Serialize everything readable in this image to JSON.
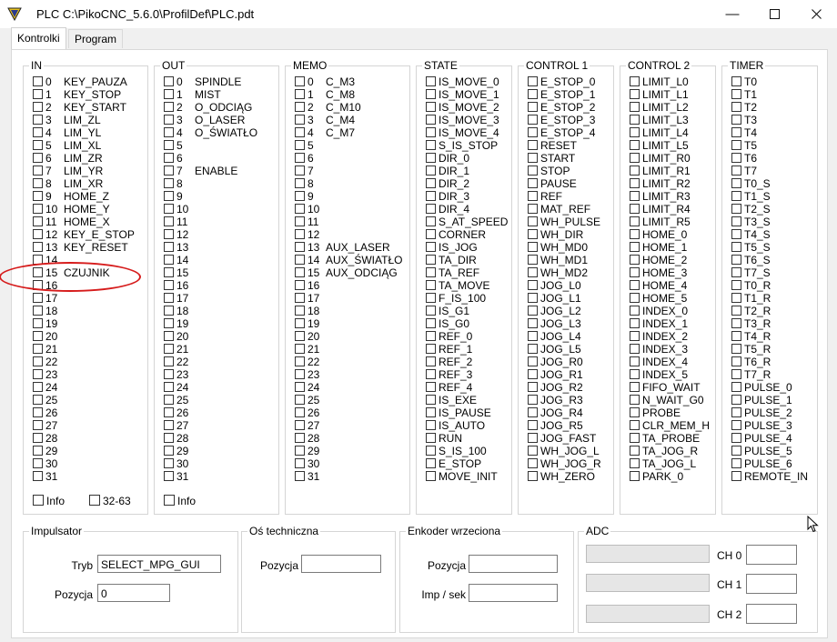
{
  "window": {
    "title": "PLC C:\\PikoCNC_5.6.0\\ProfilDef\\PLC.pdt"
  },
  "tabs": [
    {
      "label": "Kontrolki",
      "active": true
    },
    {
      "label": "Program",
      "active": false
    }
  ],
  "groups": [
    {
      "title": "IN",
      "items": [
        {
          "num": "0",
          "label": "KEY_PAUZA"
        },
        {
          "num": "1",
          "label": "KEY_STOP"
        },
        {
          "num": "2",
          "label": "KEY_START"
        },
        {
          "num": "3",
          "label": "LIM_ZL"
        },
        {
          "num": "4",
          "label": "LIM_YL"
        },
        {
          "num": "5",
          "label": "LIM_XL"
        },
        {
          "num": "6",
          "label": "LIM_ZR"
        },
        {
          "num": "7",
          "label": "LIM_YR"
        },
        {
          "num": "8",
          "label": "LIM_XR"
        },
        {
          "num": "9",
          "label": "HOME_Z"
        },
        {
          "num": "10",
          "label": "HOME_Y"
        },
        {
          "num": "11",
          "label": "HOME_X"
        },
        {
          "num": "12",
          "label": "KEY_E_STOP"
        },
        {
          "num": "13",
          "label": "KEY_RESET"
        },
        {
          "num": "14",
          "label": ""
        },
        {
          "num": "15",
          "label": "CZUJNIK"
        },
        {
          "num": "16",
          "label": ""
        },
        {
          "num": "17",
          "label": ""
        },
        {
          "num": "18",
          "label": ""
        },
        {
          "num": "19",
          "label": ""
        },
        {
          "num": "20",
          "label": ""
        },
        {
          "num": "21",
          "label": ""
        },
        {
          "num": "22",
          "label": ""
        },
        {
          "num": "23",
          "label": ""
        },
        {
          "num": "24",
          "label": ""
        },
        {
          "num": "25",
          "label": ""
        },
        {
          "num": "26",
          "label": ""
        },
        {
          "num": "27",
          "label": ""
        },
        {
          "num": "28",
          "label": ""
        },
        {
          "num": "29",
          "label": ""
        },
        {
          "num": "30",
          "label": ""
        },
        {
          "num": "31",
          "label": ""
        }
      ],
      "extra": [
        {
          "label": "Info"
        },
        {
          "label": "32-63"
        }
      ]
    },
    {
      "title": "OUT",
      "items": [
        {
          "num": "0",
          "label": "SPINDLE"
        },
        {
          "num": "1",
          "label": "MIST"
        },
        {
          "num": "2",
          "label": "O_ODCIĄG"
        },
        {
          "num": "3",
          "label": "O_LASER"
        },
        {
          "num": "4",
          "label": "O_ŚWIATŁO"
        },
        {
          "num": "5",
          "label": ""
        },
        {
          "num": "6",
          "label": ""
        },
        {
          "num": "7",
          "label": "ENABLE"
        },
        {
          "num": "8",
          "label": ""
        },
        {
          "num": "9",
          "label": ""
        },
        {
          "num": "10",
          "label": ""
        },
        {
          "num": "11",
          "label": ""
        },
        {
          "num": "12",
          "label": ""
        },
        {
          "num": "13",
          "label": ""
        },
        {
          "num": "14",
          "label": ""
        },
        {
          "num": "15",
          "label": ""
        },
        {
          "num": "16",
          "label": ""
        },
        {
          "num": "17",
          "label": ""
        },
        {
          "num": "18",
          "label": ""
        },
        {
          "num": "19",
          "label": ""
        },
        {
          "num": "20",
          "label": ""
        },
        {
          "num": "21",
          "label": ""
        },
        {
          "num": "22",
          "label": ""
        },
        {
          "num": "23",
          "label": ""
        },
        {
          "num": "24",
          "label": ""
        },
        {
          "num": "25",
          "label": ""
        },
        {
          "num": "26",
          "label": ""
        },
        {
          "num": "27",
          "label": ""
        },
        {
          "num": "28",
          "label": ""
        },
        {
          "num": "29",
          "label": ""
        },
        {
          "num": "30",
          "label": ""
        },
        {
          "num": "31",
          "label": ""
        }
      ],
      "extra": [
        {
          "label": "Info"
        }
      ]
    },
    {
      "title": "MEMO",
      "items": [
        {
          "num": "0",
          "label": "C_M3"
        },
        {
          "num": "1",
          "label": "C_M8"
        },
        {
          "num": "2",
          "label": "C_M10"
        },
        {
          "num": "3",
          "label": "C_M4"
        },
        {
          "num": "4",
          "label": "C_M7"
        },
        {
          "num": "5",
          "label": ""
        },
        {
          "num": "6",
          "label": ""
        },
        {
          "num": "7",
          "label": ""
        },
        {
          "num": "8",
          "label": ""
        },
        {
          "num": "9",
          "label": ""
        },
        {
          "num": "10",
          "label": ""
        },
        {
          "num": "11",
          "label": ""
        },
        {
          "num": "12",
          "label": ""
        },
        {
          "num": "13",
          "label": "AUX_LASER"
        },
        {
          "num": "14",
          "label": "AUX_ŚWIATŁO"
        },
        {
          "num": "15",
          "label": "AUX_ODCIĄG"
        },
        {
          "num": "16",
          "label": ""
        },
        {
          "num": "17",
          "label": ""
        },
        {
          "num": "18",
          "label": ""
        },
        {
          "num": "19",
          "label": ""
        },
        {
          "num": "20",
          "label": ""
        },
        {
          "num": "21",
          "label": ""
        },
        {
          "num": "22",
          "label": ""
        },
        {
          "num": "23",
          "label": ""
        },
        {
          "num": "24",
          "label": ""
        },
        {
          "num": "25",
          "label": ""
        },
        {
          "num": "26",
          "label": ""
        },
        {
          "num": "27",
          "label": ""
        },
        {
          "num": "28",
          "label": ""
        },
        {
          "num": "29",
          "label": ""
        },
        {
          "num": "30",
          "label": ""
        },
        {
          "num": "31",
          "label": ""
        }
      ],
      "extra": []
    },
    {
      "title": "STATE",
      "items": [
        {
          "num": "",
          "label": "IS_MOVE_0"
        },
        {
          "num": "",
          "label": "IS_MOVE_1"
        },
        {
          "num": "",
          "label": "IS_MOVE_2"
        },
        {
          "num": "",
          "label": "IS_MOVE_3"
        },
        {
          "num": "",
          "label": "IS_MOVE_4"
        },
        {
          "num": "",
          "label": "S_IS_STOP"
        },
        {
          "num": "",
          "label": "DIR_0"
        },
        {
          "num": "",
          "label": "DIR_1"
        },
        {
          "num": "",
          "label": "DIR_2"
        },
        {
          "num": "",
          "label": "DIR_3"
        },
        {
          "num": "",
          "label": "DIR_4"
        },
        {
          "num": "",
          "label": "S_AT_SPEED"
        },
        {
          "num": "",
          "label": "CORNER"
        },
        {
          "num": "",
          "label": "IS_JOG"
        },
        {
          "num": "",
          "label": "TA_DIR"
        },
        {
          "num": "",
          "label": "TA_REF"
        },
        {
          "num": "",
          "label": "TA_MOVE"
        },
        {
          "num": "",
          "label": "F_IS_100"
        },
        {
          "num": "",
          "label": "IS_G1"
        },
        {
          "num": "",
          "label": "IS_G0"
        },
        {
          "num": "",
          "label": "REF_0"
        },
        {
          "num": "",
          "label": "REF_1"
        },
        {
          "num": "",
          "label": "REF_2"
        },
        {
          "num": "",
          "label": "REF_3"
        },
        {
          "num": "",
          "label": "REF_4"
        },
        {
          "num": "",
          "label": "IS_EXE"
        },
        {
          "num": "",
          "label": "IS_PAUSE"
        },
        {
          "num": "",
          "label": "IS_AUTO"
        },
        {
          "num": "",
          "label": "RUN"
        },
        {
          "num": "",
          "label": "S_IS_100"
        },
        {
          "num": "",
          "label": "E_STOP"
        },
        {
          "num": "",
          "label": "MOVE_INIT"
        }
      ],
      "extra": []
    },
    {
      "title": "CONTROL 1",
      "items": [
        {
          "num": "",
          "label": "E_STOP_0"
        },
        {
          "num": "",
          "label": "E_STOP_1"
        },
        {
          "num": "",
          "label": "E_STOP_2"
        },
        {
          "num": "",
          "label": "E_STOP_3"
        },
        {
          "num": "",
          "label": "E_STOP_4"
        },
        {
          "num": "",
          "label": "RESET"
        },
        {
          "num": "",
          "label": "START"
        },
        {
          "num": "",
          "label": "STOP"
        },
        {
          "num": "",
          "label": "PAUSE"
        },
        {
          "num": "",
          "label": "REF"
        },
        {
          "num": "",
          "label": "MAT_REF"
        },
        {
          "num": "",
          "label": "WH_PULSE"
        },
        {
          "num": "",
          "label": "WH_DIR"
        },
        {
          "num": "",
          "label": "WH_MD0"
        },
        {
          "num": "",
          "label": "WH_MD1"
        },
        {
          "num": "",
          "label": "WH_MD2"
        },
        {
          "num": "",
          "label": "JOG_L0"
        },
        {
          "num": "",
          "label": "JOG_L1"
        },
        {
          "num": "",
          "label": "JOG_L2"
        },
        {
          "num": "",
          "label": "JOG_L3"
        },
        {
          "num": "",
          "label": "JOG_L4"
        },
        {
          "num": "",
          "label": "JOG_L5"
        },
        {
          "num": "",
          "label": "JOG_R0"
        },
        {
          "num": "",
          "label": "JOG_R1"
        },
        {
          "num": "",
          "label": "JOG_R2"
        },
        {
          "num": "",
          "label": "JOG_R3"
        },
        {
          "num": "",
          "label": "JOG_R4"
        },
        {
          "num": "",
          "label": "JOG_R5"
        },
        {
          "num": "",
          "label": "JOG_FAST"
        },
        {
          "num": "",
          "label": "WH_JOG_L"
        },
        {
          "num": "",
          "label": "WH_JOG_R"
        },
        {
          "num": "",
          "label": "WH_ZERO"
        }
      ],
      "extra": []
    },
    {
      "title": "CONTROL 2",
      "items": [
        {
          "num": "",
          "label": "LIMIT_L0"
        },
        {
          "num": "",
          "label": "LIMIT_L1"
        },
        {
          "num": "",
          "label": "LIMIT_L2"
        },
        {
          "num": "",
          "label": "LIMIT_L3"
        },
        {
          "num": "",
          "label": "LIMIT_L4"
        },
        {
          "num": "",
          "label": "LIMIT_L5"
        },
        {
          "num": "",
          "label": "LIMIT_R0"
        },
        {
          "num": "",
          "label": "LIMIT_R1"
        },
        {
          "num": "",
          "label": "LIMIT_R2"
        },
        {
          "num": "",
          "label": "LIMIT_R3"
        },
        {
          "num": "",
          "label": "LIMIT_R4"
        },
        {
          "num": "",
          "label": "LIMIT_R5"
        },
        {
          "num": "",
          "label": "HOME_0"
        },
        {
          "num": "",
          "label": "HOME_1"
        },
        {
          "num": "",
          "label": "HOME_2"
        },
        {
          "num": "",
          "label": "HOME_3"
        },
        {
          "num": "",
          "label": "HOME_4"
        },
        {
          "num": "",
          "label": "HOME_5"
        },
        {
          "num": "",
          "label": "INDEX_0"
        },
        {
          "num": "",
          "label": "INDEX_1"
        },
        {
          "num": "",
          "label": "INDEX_2"
        },
        {
          "num": "",
          "label": "INDEX_3"
        },
        {
          "num": "",
          "label": "INDEX_4"
        },
        {
          "num": "",
          "label": "INDEX_5"
        },
        {
          "num": "",
          "label": "FIFO_WAIT"
        },
        {
          "num": "",
          "label": "N_WAIT_G0"
        },
        {
          "num": "",
          "label": "PROBE"
        },
        {
          "num": "",
          "label": "CLR_MEM_H"
        },
        {
          "num": "",
          "label": "TA_PROBE"
        },
        {
          "num": "",
          "label": "TA_JOG_R"
        },
        {
          "num": "",
          "label": "TA_JOG_L"
        },
        {
          "num": "",
          "label": "PARK_0"
        }
      ],
      "extra": []
    },
    {
      "title": "TIMER",
      "items": [
        {
          "num": "",
          "label": "T0"
        },
        {
          "num": "",
          "label": "T1"
        },
        {
          "num": "",
          "label": "T2"
        },
        {
          "num": "",
          "label": "T3"
        },
        {
          "num": "",
          "label": "T4"
        },
        {
          "num": "",
          "label": "T5"
        },
        {
          "num": "",
          "label": "T6"
        },
        {
          "num": "",
          "label": "T7"
        },
        {
          "num": "",
          "label": "T0_S"
        },
        {
          "num": "",
          "label": "T1_S"
        },
        {
          "num": "",
          "label": "T2_S"
        },
        {
          "num": "",
          "label": "T3_S"
        },
        {
          "num": "",
          "label": "T4_S"
        },
        {
          "num": "",
          "label": "T5_S"
        },
        {
          "num": "",
          "label": "T6_S"
        },
        {
          "num": "",
          "label": "T7_S"
        },
        {
          "num": "",
          "label": "T0_R"
        },
        {
          "num": "",
          "label": "T1_R"
        },
        {
          "num": "",
          "label": "T2_R"
        },
        {
          "num": "",
          "label": "T3_R"
        },
        {
          "num": "",
          "label": "T4_R"
        },
        {
          "num": "",
          "label": "T5_R"
        },
        {
          "num": "",
          "label": "T6_R"
        },
        {
          "num": "",
          "label": "T7_R"
        },
        {
          "num": "",
          "label": "PULSE_0"
        },
        {
          "num": "",
          "label": "PULSE_1"
        },
        {
          "num": "",
          "label": "PULSE_2"
        },
        {
          "num": "",
          "label": "PULSE_3"
        },
        {
          "num": "",
          "label": "PULSE_4"
        },
        {
          "num": "",
          "label": "PULSE_5"
        },
        {
          "num": "",
          "label": "PULSE_6"
        },
        {
          "num": "",
          "label": "REMOTE_IN"
        }
      ],
      "extra": []
    }
  ],
  "impulsator": {
    "title": "Impulsator",
    "tryb_label": "Tryb",
    "tryb_value": "SELECT_MPG_GUI",
    "pozycja_label": "Pozycja",
    "pozycja_value": "0"
  },
  "os": {
    "title": "Oś techniczna",
    "pozycja_label": "Pozycja",
    "pozycja_value": ""
  },
  "enkoder": {
    "title": "Enkoder wrzeciona",
    "pozycja_label": "Pozycja",
    "pozycja_value": "",
    "imp_label": "Imp / sek",
    "imp_value": ""
  },
  "adc": {
    "title": "ADC",
    "channels": [
      {
        "label": "CH 0",
        "value": ""
      },
      {
        "label": "CH 1",
        "value": ""
      },
      {
        "label": "CH 2",
        "value": ""
      }
    ]
  },
  "colors": {
    "highlight": "#d61c1c",
    "border": "#d5d5d5"
  }
}
